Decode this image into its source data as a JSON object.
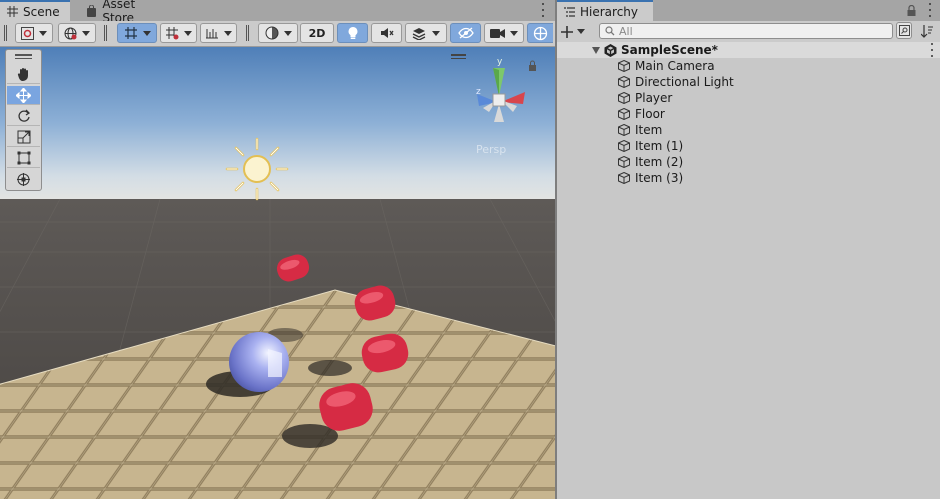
{
  "scene_panel": {
    "tabs": [
      {
        "label": "Scene",
        "icon": "grid-icon",
        "active": true
      },
      {
        "label": "Asset Store",
        "icon": "bag-icon",
        "active": false
      }
    ],
    "toolbar": {
      "mode_2d_label": "2D"
    },
    "tools": [
      "hand-tool",
      "move-tool",
      "rotate-tool",
      "scale-tool",
      "rect-tool",
      "transform-tool"
    ],
    "gizmo_axes": {
      "y": "y",
      "z": "z"
    },
    "gizmo_projection_label": "Persp",
    "colors": {
      "accent": "#3a72b0",
      "toggle_on": "#80a8dc",
      "item_red": "#e0304a",
      "player_sphere": "#8d96e6"
    }
  },
  "hierarchy": {
    "tab_label": "Hierarchy",
    "search_placeholder": "All",
    "scene_name": "SampleScene*",
    "items": [
      "Main Camera",
      "Directional Light",
      "Player",
      "Floor",
      "Item",
      "Item (1)",
      "Item (2)",
      "Item (3)"
    ]
  }
}
